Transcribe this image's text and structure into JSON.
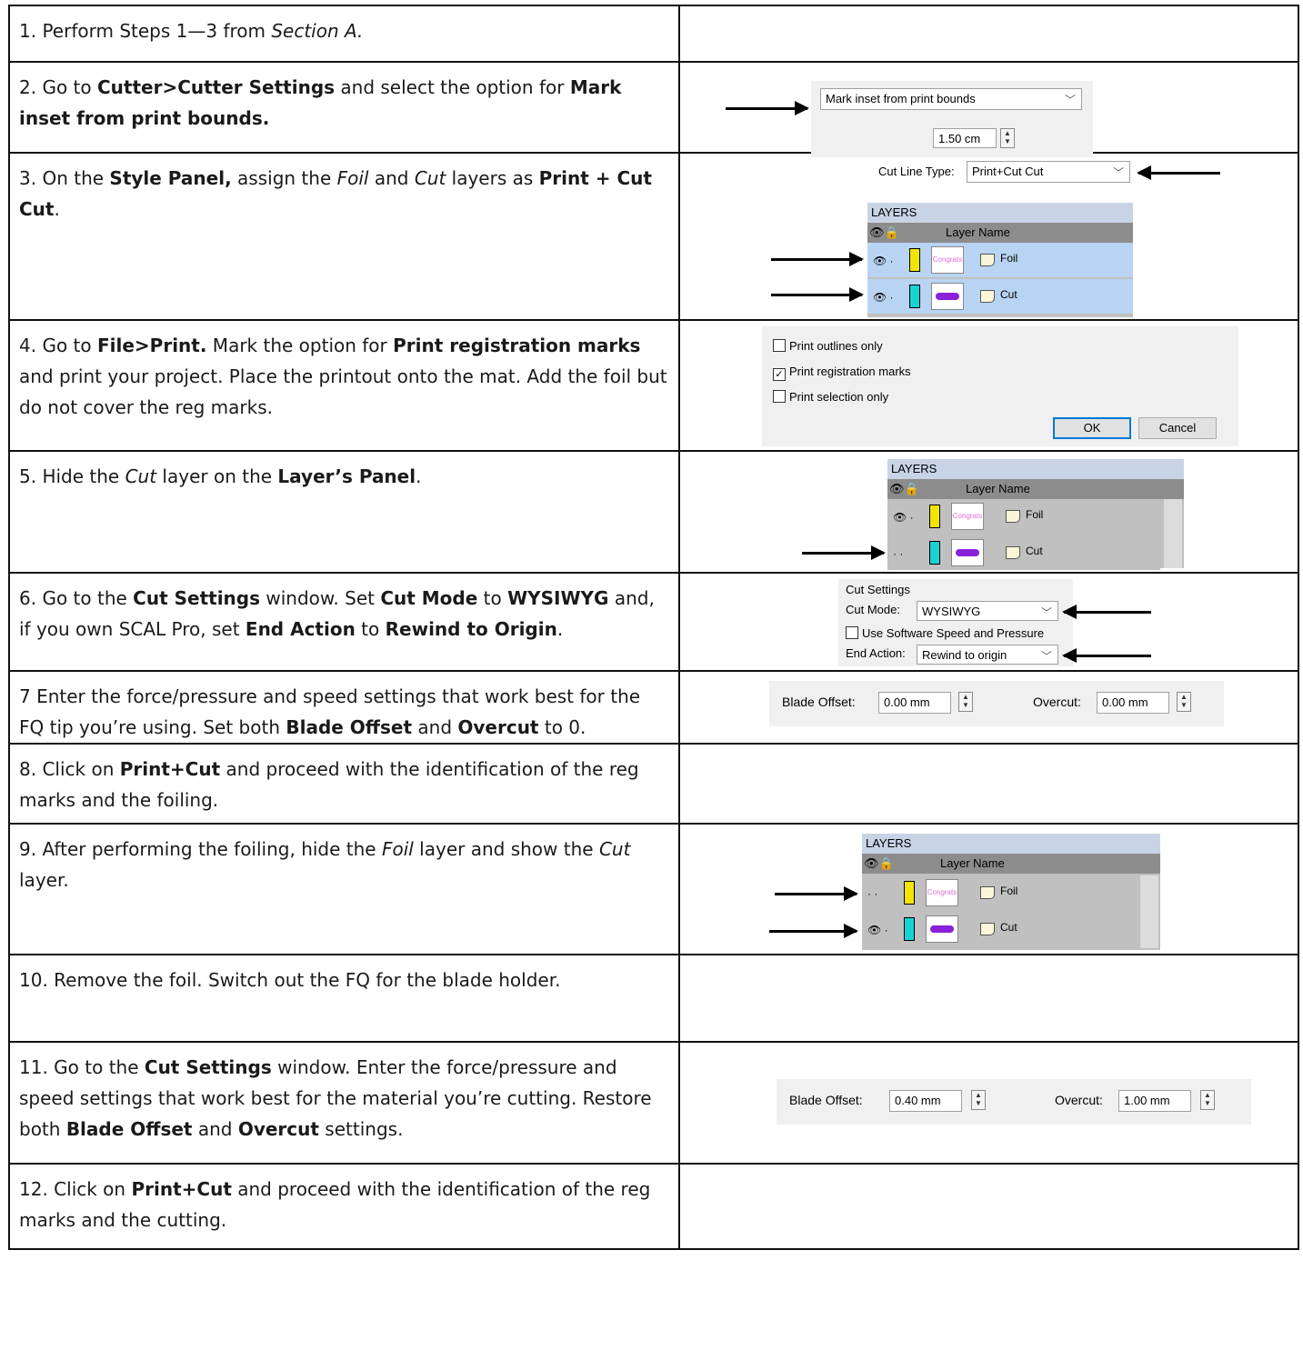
{
  "steps": [
    {
      "num": "1.",
      "t1": "Perform Steps 1—3 from ",
      "i1": "Section A."
    },
    {
      "num": "2.",
      "t1": "Go to ",
      "b1": "Cutter>Cutter Settings",
      "t2": " and select the option for ",
      "b2": "Mark inset from print bounds."
    },
    {
      "num": "3.",
      "t1": "On the ",
      "b1": "Style Panel,",
      "t2": " assign the ",
      "i1": "Foil",
      "t3": " and ",
      "i2": "Cut",
      "t4": " layers as ",
      "b2": "Print + Cut Cut",
      "t5": "."
    },
    {
      "num": "4.",
      "t1": "Go to ",
      "b1": "File>Print.",
      "t2": " Mark the option for ",
      "b2": "Print registration marks",
      "t3": " and print your project. Place the printout onto the mat. Add the foil but do not cover the reg marks."
    },
    {
      "num": "5.",
      "t1": "Hide the ",
      "i1": "Cut",
      "t2": " layer on the ",
      "b1": "Layer’s Panel",
      "t3": "."
    },
    {
      "num": "6.",
      "t1": "Go to the ",
      "b1": "Cut Settings",
      "t2": " window. Set ",
      "b2": "Cut Mode",
      "t3": " to ",
      "b3": "WYSIWYG",
      "t4": " and, if you own SCAL Pro, set ",
      "b4": "End Action",
      "t5": " to ",
      "b5": "Rewind to Origin",
      "t6": "."
    },
    {
      "num": "7",
      "t1": "Enter the force/pressure and speed settings that work best for the FQ tip you’re using. Set both  ",
      "b1": "Blade Offset",
      "t2": " and ",
      "b2": "Overcut",
      "t3": " to 0."
    },
    {
      "num": "8.",
      "t1": "Click on ",
      "b1": "Print+Cut",
      "t2": " and proceed with the identification of the reg marks and the foiling."
    },
    {
      "num": "9.",
      "t1": "After performing the foiling, hide the ",
      "i1": "Foil",
      "t2": " layer and show the ",
      "i2": "Cut",
      "t3": " layer."
    },
    {
      "num": "10.",
      "t1": "Remove the foil.  Switch out the FQ for the blade holder."
    },
    {
      "num": "11.",
      "t1": "Go to the ",
      "b1": "Cut Settings",
      "t2": " window. Enter the force/pressure and speed settings that work best for the material you’re cutting. Restore both  ",
      "b2": "Blade Offset",
      "t3": " and ",
      "b3": "Overcut",
      "t4": " settings."
    },
    {
      "num": "12.",
      "t1": "Click on ",
      "b1": "Print+Cut",
      "t2": " and proceed with the identification of the reg marks and the cutting."
    }
  ],
  "ui": {
    "mark_option": "Mark inset from print bounds",
    "inset_value": "1.50 cm",
    "cut_line_type_label": "Cut Line Type:",
    "cut_line_type_value": "Print+Cut Cut",
    "layers_title": "LAYERS",
    "layer_name_header": "Layer Name",
    "layer_foil": "Foil",
    "layer_cut": "Cut",
    "thumb_text": "Congrats",
    "print_outlines": "Print outlines only",
    "print_reg_marks": "Print registration marks",
    "print_selection": "Print selection only",
    "ok": "OK",
    "cancel": "Cancel",
    "cut_settings_title": "Cut Settings",
    "cut_mode_label": "Cut Mode:",
    "cut_mode_value": "WYSIWYG",
    "use_software": "Use Software Speed and Pressure",
    "end_action_label": "End Action:",
    "end_action_value": "Rewind to origin",
    "blade_offset_label": "Blade Offset:",
    "overcut_label": "Overcut:",
    "blade_offset_a": "0.00 mm",
    "overcut_a": "0.00 mm",
    "blade_offset_b": "0.40 mm",
    "overcut_b": "1.00 mm"
  },
  "colors": {
    "foil_swatch": "#f2e600",
    "cut_swatch": "#19d3d3",
    "selected_row": "#b8d4f2",
    "thumb_foil": "#e070d0",
    "thumb_cut": "#8a20d8"
  }
}
